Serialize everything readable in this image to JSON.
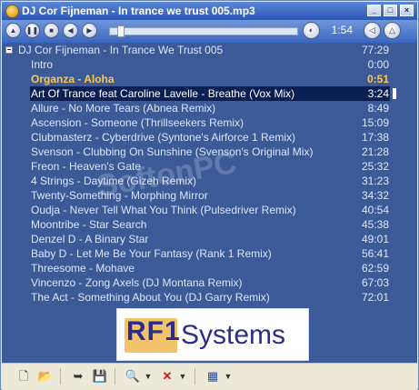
{
  "window": {
    "title": "DJ Cor Fijneman - In trance we trust 005.mp3",
    "titlebar_buttons": [
      "_",
      "□",
      "×"
    ]
  },
  "controls": {
    "current_time": "1:54",
    "progress_fraction": 0.04
  },
  "playlist": {
    "header": {
      "title": "DJ Cor Fijneman - In Trance We Trust 005",
      "duration": "77:29"
    },
    "tracks": [
      {
        "title": "Intro",
        "duration": "0:00"
      },
      {
        "title": "Organza -  Aloha",
        "duration": "0:51",
        "state": "playing"
      },
      {
        "title": "Art Of Trance feat Caroline Lavelle -  Breathe (Vox Mix)",
        "duration": "3:24",
        "state": "selected"
      },
      {
        "title": "Allure -  No More Tears (Abnea Remix)",
        "duration": "8:49"
      },
      {
        "title": "Ascension -  Someone (Thrillseekers Remix)",
        "duration": "15:09"
      },
      {
        "title": "Clubmasterz -  Cyberdrive (Syntone's Airforce 1 Remix)",
        "duration": "17:38"
      },
      {
        "title": "Svenson -  Clubbing On Sunshine (Svenson's Original Mix)",
        "duration": "21:28"
      },
      {
        "title": "Freon -  Heaven's Gate",
        "duration": "25:32"
      },
      {
        "title": "4 Strings -  Daytime (Gizeh Remix)",
        "duration": "31:23"
      },
      {
        "title": "Twenty-Something -  Morphing Mirror",
        "duration": "34:32"
      },
      {
        "title": "Oudja -  Never Tell What You Think (Pulsedriver Remix)",
        "duration": "40:54"
      },
      {
        "title": "Moontribe -  Star Search",
        "duration": "45:38"
      },
      {
        "title": "Denzel D -  A Binary Star",
        "duration": "49:01"
      },
      {
        "title": "Baby D -  Let Me Be Your Fantasy (Rank 1 Remix)",
        "duration": "56:41"
      },
      {
        "title": "Threesome -  Mohave",
        "duration": "62:59"
      },
      {
        "title": "Vincenzo -  Zong Axels (DJ Montana Remix)",
        "duration": "67:03"
      },
      {
        "title": "The Act -  Something About You (DJ Garry Remix)",
        "duration": "72:01"
      }
    ]
  },
  "logo": {
    "part1": "RF1",
    "part2": "Systems"
  },
  "watermark": "SoftonPC",
  "colors": {
    "list_bg": "#3c5a98",
    "playing": "#ffc64a",
    "selected_bg": "#0a1f52",
    "text": "#dce6fb"
  },
  "icons": [
    "new-file-icon",
    "open-folder-icon",
    "import-icon",
    "save-icon",
    "search-icon",
    "delete-icon",
    "view-options-icon"
  ]
}
